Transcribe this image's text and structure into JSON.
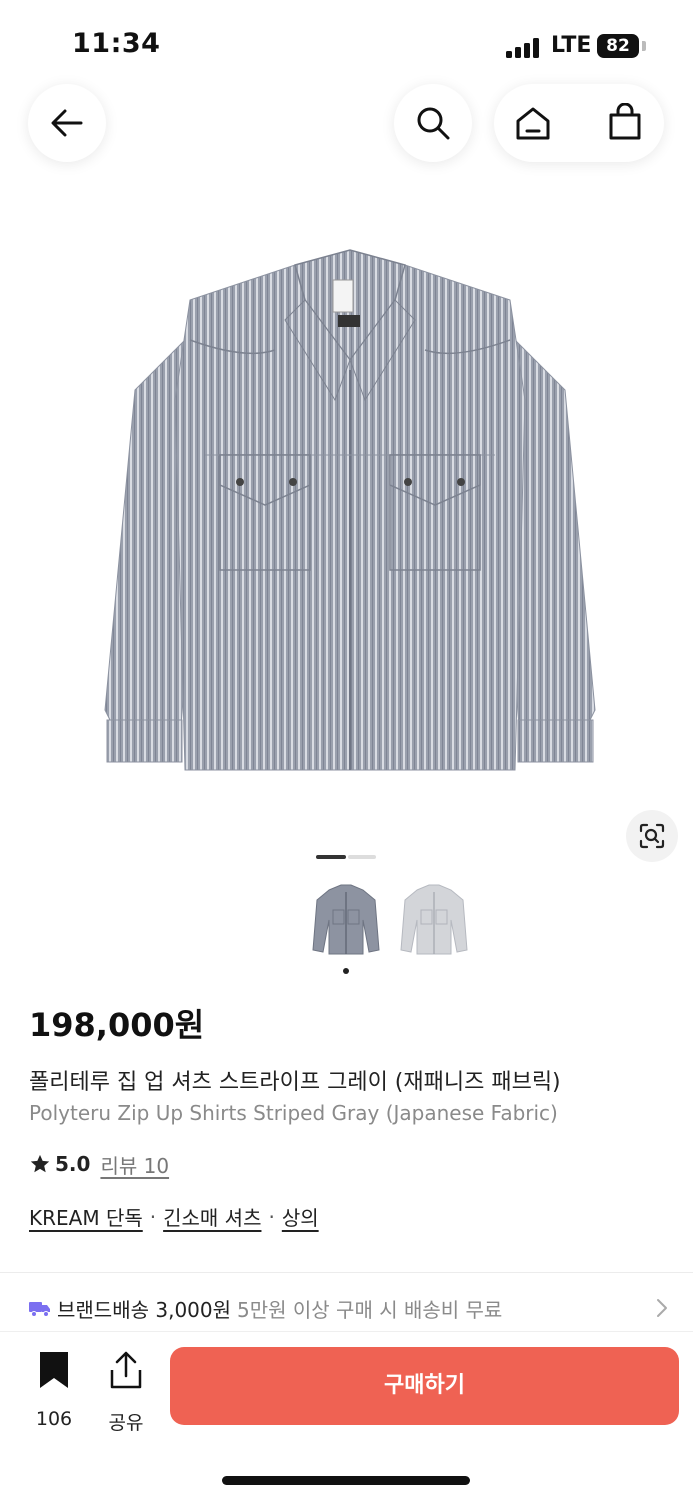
{
  "status_bar": {
    "time": "11:34",
    "network": "LTE",
    "battery": "82"
  },
  "nav": {
    "back_icon": "arrow-left-icon",
    "search_icon": "search-icon",
    "home_icon": "home-icon",
    "cart_icon": "shopping-bag-icon"
  },
  "gallery": {
    "main_image_icon": "striped-gray-shirt-image",
    "lens_icon": "visual-search-icon",
    "current_index": 1,
    "total_images": 2
  },
  "product": {
    "price": "198,000원",
    "name_ko": "폴리테루 집 업 셔츠 스트라이프 그레이 (재패니즈 패브릭)",
    "name_en": "Polyteru Zip Up Shirts Striped Gray (Japanese Fabric)",
    "rating": "5.0",
    "review_link": "리뷰 10",
    "tags": [
      "KREAM 단독",
      "긴소매 셔츠",
      "상의"
    ],
    "tag_separator": "·"
  },
  "shipping": {
    "icon": "truck-icon",
    "label": "브랜드배송 3,000원",
    "note": "5만원 이상 구매 시 배송비 무료"
  },
  "bottom_bar": {
    "bookmark_count": "106",
    "share_label": "공유",
    "buy_label": "구매하기",
    "buy_color": "#ef6253"
  }
}
